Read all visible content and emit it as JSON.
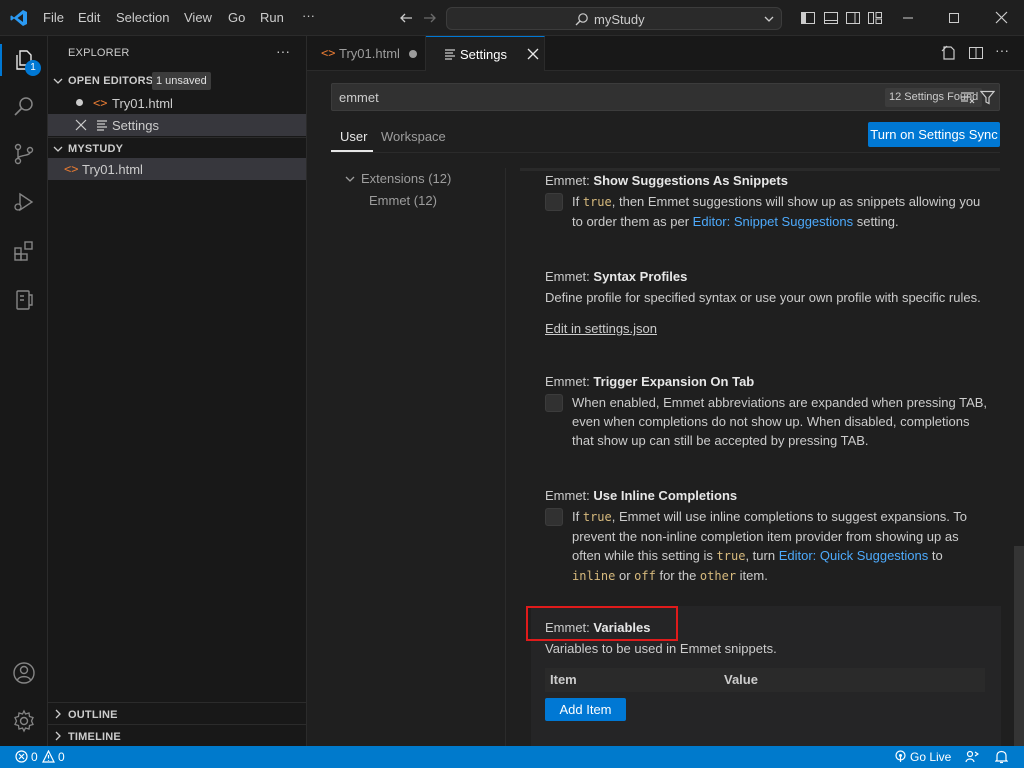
{
  "titlebar": {
    "menu": [
      "File",
      "Edit",
      "Selection",
      "View",
      "Go",
      "Run",
      "···"
    ],
    "command_center": "myStudy"
  },
  "activity": {
    "explorer_badge": "1"
  },
  "sidebar": {
    "title": "EXPLORER",
    "more": "···",
    "open_editors": {
      "label": "OPEN EDITORS",
      "badge": "1 unsaved",
      "items": [
        "Try01.html",
        "Settings"
      ]
    },
    "folder": {
      "label": "MYSTUDY",
      "items": [
        "Try01.html"
      ]
    },
    "outline": "OUTLINE",
    "timeline": "TIMELINE"
  },
  "tabs": [
    {
      "label": "Try01.html"
    },
    {
      "label": "Settings"
    }
  ],
  "settings": {
    "search_value": "emmet",
    "found": "12 Settings Found",
    "scopes": [
      "User",
      "Workspace"
    ],
    "sync_button": "Turn on Settings Sync",
    "toc": {
      "group": "Extensions (12)",
      "child": "Emmet (12)"
    },
    "items": [
      {
        "category": "Emmet: ",
        "name": "Show Suggestions As Snippets",
        "d1": "If ",
        "c1": "true",
        "d2": ", then Emmet suggestions will show up as snippets allowing you",
        "d3": "to order them as per ",
        "link": "Editor: Snippet Suggestions",
        "d4": " setting."
      },
      {
        "category": "Emmet: ",
        "name": "Syntax Profiles",
        "desc": "Define profile for specified syntax or use your own profile with specific rules.",
        "edit_link": "Edit in settings.json"
      },
      {
        "category": "Emmet: ",
        "name": "Trigger Expansion On Tab",
        "l1": "When enabled, Emmet abbreviations are expanded when pressing TAB,",
        "l2": "even when completions do not show up. When disabled, completions",
        "l3": "that show up can still be accepted by pressing TAB."
      },
      {
        "category": "Emmet: ",
        "name": "Use Inline Completions",
        "l1a": "If ",
        "l1c": "true",
        "l1b": ", Emmet will use inline completions to suggest expansions. To",
        "l2": "prevent the non-inline completion item provider from showing up as",
        "l3a": "often while this setting is ",
        "l3c": "true",
        "l3b": ", turn ",
        "l3link": "Editor: Quick Suggestions",
        "l3d": " to",
        "l4c1": "inline",
        "l4a": " or ",
        "l4c2": "off",
        "l4b": " for the ",
        "l4c3": "other",
        "l4d": " item."
      },
      {
        "category": "Emmet: ",
        "name": "Variables",
        "desc": "Variables to be used in Emmet snippets.",
        "col_item": "Item",
        "col_value": "Value",
        "add_button": "Add Item"
      }
    ]
  },
  "statusbar": {
    "errors": "0",
    "warnings": "0",
    "golive": "Go Live"
  },
  "colors": {
    "accent": "#0078d4",
    "status": "#007acc",
    "highlight_box": "#e01b1b"
  }
}
